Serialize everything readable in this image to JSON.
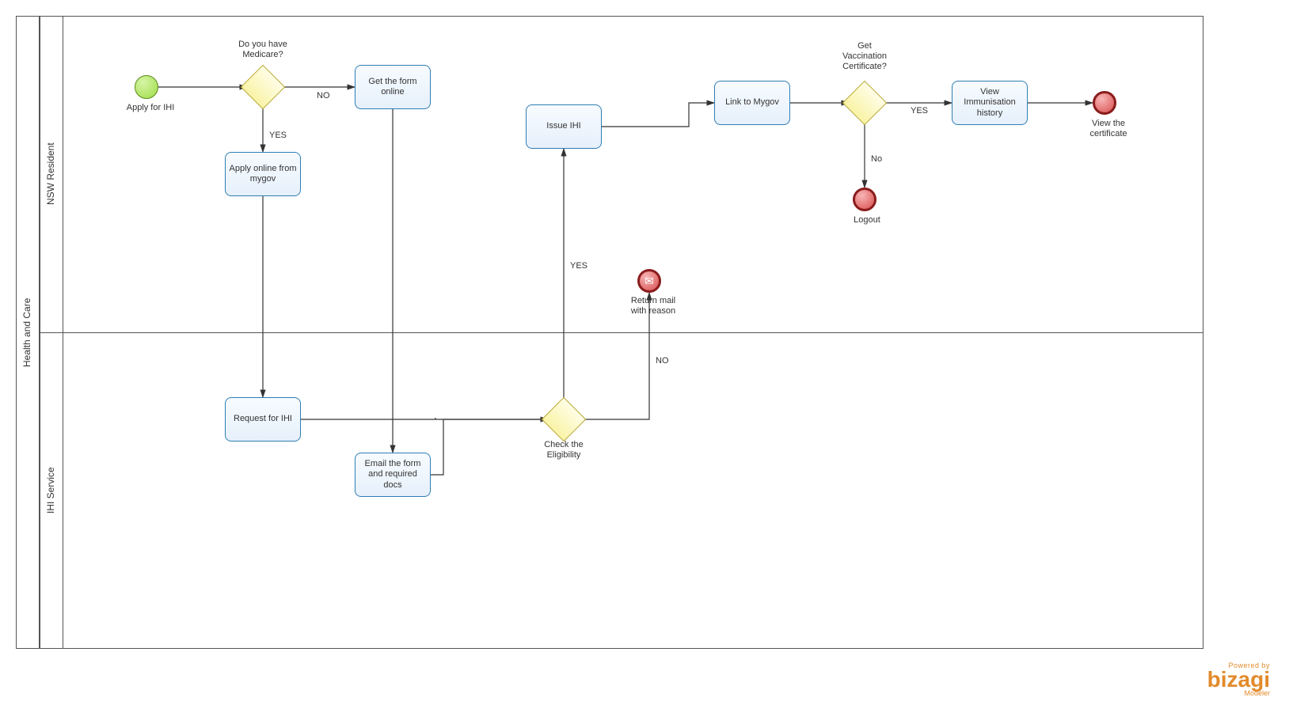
{
  "pool": {
    "name": "Health and Care"
  },
  "lanes": {
    "top": "NSW Resident",
    "bottom": "IHI Service"
  },
  "events": {
    "start": {
      "label": "Apply for IHI"
    },
    "endView": {
      "label": "View the\ncertificate"
    },
    "endLogout": {
      "label": "Logout"
    },
    "endMail": {
      "label": "Return mail\nwith reason"
    }
  },
  "gateways": {
    "g1": {
      "label": "Do you have\nMedicare?",
      "yes": "YES",
      "no": "NO"
    },
    "g2": {
      "label": "Check the\nEligibility",
      "yes": "YES",
      "no": "NO"
    },
    "g3": {
      "label": "Get\nVaccination\nCertificate?",
      "yes": "YES",
      "no": "No"
    }
  },
  "tasks": {
    "getForm": "Get the form online",
    "applyOnline": "Apply online from mygov",
    "requestIHI": "Request for IHI",
    "emailForm": "Email the form and required docs",
    "issueIHI": "Issue IHI",
    "linkMygov": "Link to Mygov",
    "viewHistory": "View Immunisation history"
  },
  "footer": {
    "powered": "Powered by",
    "brand": "bizagi",
    "sub": "Modeler"
  }
}
